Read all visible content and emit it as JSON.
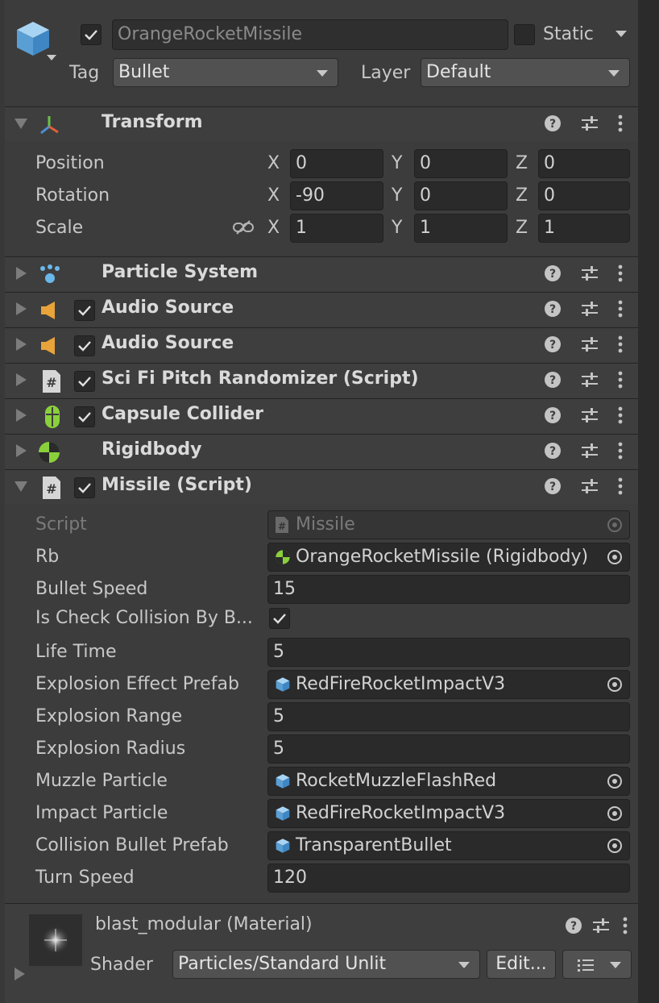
{
  "gameobject": {
    "name": "OrangeRocketMissile",
    "static_label": "Static",
    "tag_label": "Tag",
    "tag_value": "Bullet",
    "layer_label": "Layer",
    "layer_value": "Default"
  },
  "transform": {
    "title": "Transform",
    "rows": [
      {
        "label": "Position",
        "x": "0",
        "y": "0",
        "z": "0"
      },
      {
        "label": "Rotation",
        "x": "-90",
        "y": "0",
        "z": "0"
      },
      {
        "label": "Scale",
        "x": "1",
        "y": "1",
        "z": "1"
      }
    ],
    "axis_x": "X",
    "axis_y": "Y",
    "axis_z": "Z"
  },
  "components": [
    {
      "title": "Particle System"
    },
    {
      "title": "Audio Source"
    },
    {
      "title": "Audio Source"
    },
    {
      "title": "Sci Fi Pitch Randomizer (Script)"
    },
    {
      "title": "Capsule Collider"
    },
    {
      "title": "Rigidbody"
    },
    {
      "title": "Missile (Script)"
    }
  ],
  "missile": {
    "script_label": "Script",
    "script_value": "Missile",
    "rb_label": "Rb",
    "rb_value": "OrangeRocketMissile (Rigidbody)",
    "bullet_speed_label": "Bullet Speed",
    "bullet_speed_value": "15",
    "check_collision_label": "Is Check Collision By B...",
    "life_time_label": "Life Time",
    "life_time_value": "5",
    "explosion_effect_label": "Explosion Effect Prefab",
    "explosion_effect_value": "RedFireRocketImpactV3",
    "explosion_range_label": "Explosion Range",
    "explosion_range_value": "5",
    "explosion_radius_label": "Explosion Radius",
    "explosion_radius_value": "5",
    "muzzle_label": "Muzzle Particle",
    "muzzle_value": "RocketMuzzleFlashRed",
    "impact_label": "Impact Particle",
    "impact_value": "RedFireRocketImpactV3",
    "collision_bullet_label": "Collision Bullet Prefab",
    "collision_bullet_value": "TransparentBullet",
    "turn_speed_label": "Turn Speed",
    "turn_speed_value": "120"
  },
  "material": {
    "title": "blast_modular (Material)",
    "shader_label": "Shader",
    "shader_value": "Particles/Standard Unlit",
    "edit_label": "Edit..."
  },
  "colors": {
    "background": "#3c3c3c",
    "field": "#2a2a2a",
    "header": "#3e3e3e",
    "prefab_blue": "#8ab8e0",
    "rigidbody_green": "#8ad03c",
    "audio_orange": "#e8a33a"
  }
}
